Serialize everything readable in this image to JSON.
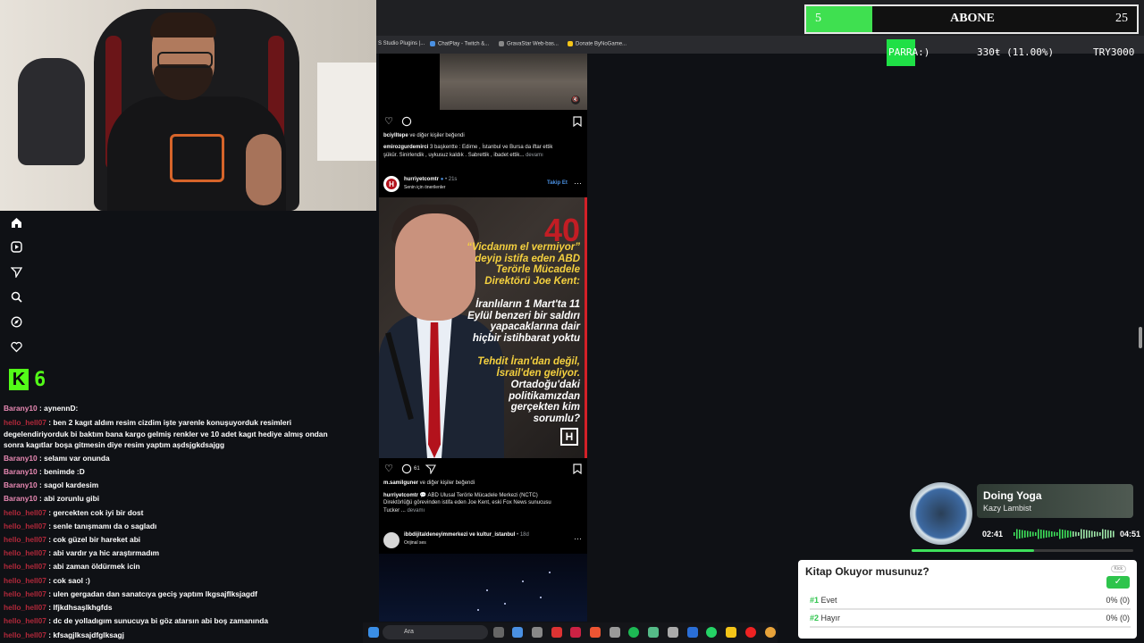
{
  "topbar": {
    "abone_left": "5",
    "abone_center": "ABONE",
    "abone_right": "25",
    "abone_fill_pct": 20
  },
  "ticker": {
    "label": "PARRA:)",
    "change": "330ŧ (11.00%)",
    "target": "TRY3000"
  },
  "bookmarks": [
    {
      "label": "S Studio Plugins |...",
      "color": "#3b3b3b"
    },
    {
      "label": "ChatPlay - Twitch &...",
      "color": "#4a90e2"
    },
    {
      "label": "GravaStar Web-bas...",
      "color": "#888888"
    },
    {
      "label": "Donate ByNoGame...",
      "color": "#f5c518"
    }
  ],
  "kick": {
    "viewers": "6"
  },
  "chat": [
    {
      "user": "Barany10",
      "msg": " : aynennD:",
      "type": "b"
    },
    {
      "user": "hello_hell07",
      "msg": " : ben 2 kagıt aldım resim cizdim işte yarenle konuşuyorduk resimleri degelendiriyorduk bi baktım bana kargo gelmiş renkler ve 10 adet kagıt hediye almış ondan sonra kagıtlar boşa gitmesin diye resim yaptım aşdsjgkdsajgg",
      "type": "h",
      "wrap": true
    },
    {
      "user": "Barany10",
      "msg": " : selamı var onunda",
      "type": "b"
    },
    {
      "user": "Barany10",
      "msg": " : benimde :D",
      "type": "b"
    },
    {
      "user": "Barany10",
      "msg": " : sagol kardesim",
      "type": "b"
    },
    {
      "user": "Barany10",
      "msg": " : abi zorunlu gibi",
      "type": "b"
    },
    {
      "user": "hello_hell07",
      "msg": " : gercekten cok iyi bir dost",
      "type": "h"
    },
    {
      "user": "hello_hell07",
      "msg": " : senle tanışmamı da o sagladı",
      "type": "h"
    },
    {
      "user": "hello_hell07",
      "msg": " : cok güzel bir hareket abi",
      "type": "h"
    },
    {
      "user": "hello_hell07",
      "msg": " : abi vardır ya hic araştırmadım",
      "type": "h"
    },
    {
      "user": "hello_hell07",
      "msg": " : abi zaman öldürmek icin",
      "type": "h"
    },
    {
      "user": "hello_hell07",
      "msg": " : cok saol :)",
      "type": "h"
    },
    {
      "user": "hello_hell07",
      "msg": " : ulen gergadan dan sanatcıya geciş yaptım lkgsajflksjagdf",
      "type": "h"
    },
    {
      "user": "hello_hell07",
      "msg": " : lfjkdhsaşlkhgfds",
      "type": "h"
    },
    {
      "user": "hello_hell07",
      "msg": " : dc de yolladıgım sunucuya bi göz atarsın abi boş zamanında",
      "type": "h"
    },
    {
      "user": "hello_hell07",
      "msg": " : kfsagjlksajdfglksagj",
      "type": "h"
    }
  ],
  "feed": {
    "post1": {
      "liked_user": "bciylltepe",
      "liked_suffix": " ve diğer kişiler beğendi",
      "author": "emirozgurdemirci",
      "caption1": " 3 başkentte : Edirne , İstanbul ve Bursa da iftar ettik",
      "caption2": "şükür. Sinirlendik , uykusuz kaldık . Sabrettik , ibadet ettik...",
      "more": " devamı"
    },
    "post2": {
      "account": "hurriyetcomtr",
      "time": "• 21s",
      "subtitle": "Senin için önerilenler",
      "follow": "Takip Et",
      "logo_letter": "H",
      "img_lines_yellow": [
        "“Vicdanım el vermiyor”",
        "deyip istifa eden ABD",
        "Terörle Mücadele",
        "Direktörü Joe Kent:"
      ],
      "img_lines_white": [
        "İranlıların 1 Mart'ta 11",
        "Eylül benzeri bir saldırı",
        "yapacaklarına dair",
        "hiçbir istihbarat yoktu"
      ],
      "img_lines_yellow2": [
        "Tehdit İran'dan değil,",
        "İsrail'den geliyor."
      ],
      "img_lines_white2": [
        "Ortadoğu'daki",
        "politikamızdan",
        "gerçekten kim",
        "sorumlu?"
      ],
      "comments": "61",
      "liked_user": "m.samilguner",
      "liked_suffix": " ve diğer kişiler beğendi",
      "author": "hurriyetcomtr",
      "caption1": " 💬 ABD Ulusal Terörle Mücadele Merkezi (NCTC)",
      "caption2": "Direktörlüğü görevinden istifa eden Joe Kent, eski Fox News sunucusu",
      "caption3": "Tucker ...",
      "more": " devamı"
    },
    "post3": {
      "account": "ibbdijitaldeneyimmerkezi ve kultur_istanbul",
      "time": "• 18d",
      "subtitle": "Orijinal ses"
    }
  },
  "music": {
    "title": "Doing Yoga",
    "artist": "Kazy Lambist",
    "elapsed": "02:41",
    "duration": "04:51",
    "progress": 0.553
  },
  "poll": {
    "question": "Kitap Okuyor musunuz?",
    "badge": "Kick",
    "options": [
      {
        "num": "#1",
        "label": " Evet",
        "pct": "0% (0)"
      },
      {
        "num": "#2",
        "label": " Hayır",
        "pct": "0% (0)"
      }
    ]
  },
  "taskbar": {
    "search_placeholder": "Ara"
  },
  "colors": {
    "kick_green": "#53fc18",
    "chat_user_b": "#e889b3",
    "chat_user_h": "#b0283a",
    "hurriyet_red": "#d32027",
    "poll_green": "#2ec44c"
  }
}
